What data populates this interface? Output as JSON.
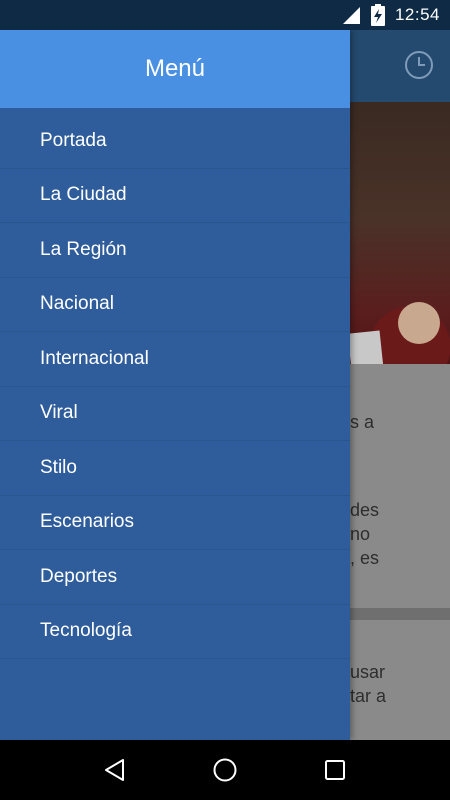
{
  "status_bar": {
    "time": "12:54",
    "icons": [
      "signal-icon",
      "battery-charging-icon"
    ]
  },
  "drawer": {
    "title": "Menú",
    "items": [
      {
        "label": "Portada"
      },
      {
        "label": "La Ciudad"
      },
      {
        "label": "La Región"
      },
      {
        "label": "Nacional"
      },
      {
        "label": "Internacional"
      },
      {
        "label": "Viral"
      },
      {
        "label": "Stilo"
      },
      {
        "label": "Escenarios"
      },
      {
        "label": "Deportes"
      },
      {
        "label": "Tecnología"
      }
    ]
  },
  "background": {
    "card1_line1": "s a",
    "card1_line2": "des",
    "card1_line3": "no",
    "card1_line4": ", es",
    "card2_line1": "usar",
    "card2_line2": "tar a"
  },
  "colors": {
    "drawer_header": "#4a90e2",
    "drawer_body": "#2f5d9c",
    "status_bar": "#0f2a45"
  },
  "nav": {
    "icons": [
      "back-icon",
      "home-icon",
      "recents-icon"
    ]
  }
}
